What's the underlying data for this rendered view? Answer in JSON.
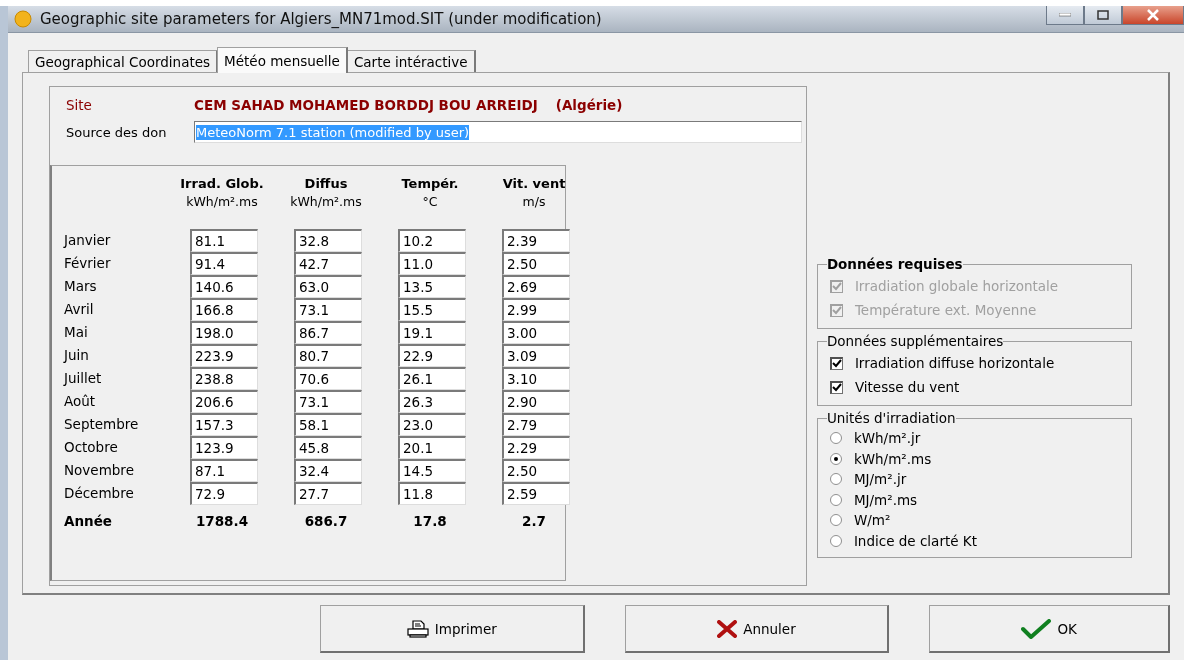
{
  "window": {
    "title": "Geographic site parameters for Algiers_MN71mod.SIT (under modification)"
  },
  "tabs": [
    {
      "label": "Geographical Coordinates",
      "selected": false
    },
    {
      "label": "Météo mensuelle",
      "selected": true
    },
    {
      "label": "Carte intéractive",
      "selected": false
    }
  ],
  "site": {
    "label": "Site",
    "name": "CEM SAHAD MOHAMED BORDDJ BOU ARREIDJ",
    "country": "(Algérie)"
  },
  "source": {
    "label": "Source des don",
    "value": "MeteoNorm 7.1 station (modified by user)",
    "text_selected": true
  },
  "table": {
    "columns": [
      {
        "title": "Irrad. Glob.",
        "unit": "kWh/m².ms"
      },
      {
        "title": "Diffus",
        "unit": "kWh/m².ms"
      },
      {
        "title": "Tempér.",
        "unit": "°C"
      },
      {
        "title": "Vit. vent",
        "unit": "m/s"
      }
    ],
    "rows": [
      {
        "month": "Janvier",
        "values": [
          "81.1",
          "32.8",
          "10.2",
          "2.39"
        ]
      },
      {
        "month": "Février",
        "values": [
          "91.4",
          "42.7",
          "11.0",
          "2.50"
        ]
      },
      {
        "month": "Mars",
        "values": [
          "140.6",
          "63.0",
          "13.5",
          "2.69"
        ]
      },
      {
        "month": "Avril",
        "values": [
          "166.8",
          "73.1",
          "15.5",
          "2.99"
        ]
      },
      {
        "month": "Mai",
        "values": [
          "198.0",
          "86.7",
          "19.1",
          "3.00"
        ]
      },
      {
        "month": "Juin",
        "values": [
          "223.9",
          "80.7",
          "22.9",
          "3.09"
        ]
      },
      {
        "month": "Juillet",
        "values": [
          "238.8",
          "70.6",
          "26.1",
          "3.10"
        ]
      },
      {
        "month": "Août",
        "values": [
          "206.6",
          "73.1",
          "26.3",
          "2.90"
        ]
      },
      {
        "month": "Septembre",
        "values": [
          "157.3",
          "58.1",
          "23.0",
          "2.79"
        ]
      },
      {
        "month": "Octobre",
        "values": [
          "123.9",
          "45.8",
          "20.1",
          "2.29"
        ]
      },
      {
        "month": "Novembre",
        "values": [
          "87.1",
          "32.4",
          "14.5",
          "2.50"
        ]
      },
      {
        "month": "Décembre",
        "values": [
          "72.9",
          "27.7",
          "11.8",
          "2.59"
        ]
      }
    ],
    "total": {
      "label": "Année",
      "values": [
        "1788.4",
        "686.7",
        "17.8",
        "2.7"
      ]
    }
  },
  "required": {
    "title": "Données requises",
    "items": [
      {
        "label": "Irradiation globale horizontale",
        "checked": true,
        "disabled": true
      },
      {
        "label": "Température ext. Moyenne",
        "checked": true,
        "disabled": true
      }
    ]
  },
  "extra": {
    "title": "Données supplémentaires",
    "items": [
      {
        "label": "Irradiation diffuse horizontale",
        "checked": true,
        "disabled": false
      },
      {
        "label": "Vitesse du vent",
        "checked": true,
        "disabled": false
      }
    ]
  },
  "units": {
    "title": "Unités d'irradiation",
    "options": [
      {
        "label": "kWh/m².jr",
        "selected": false
      },
      {
        "label": "kWh/m².ms",
        "selected": true
      },
      {
        "label": "MJ/m².jr",
        "selected": false
      },
      {
        "label": "MJ/m².ms",
        "selected": false
      },
      {
        "label": "W/m²",
        "selected": false
      },
      {
        "label": "Indice de clarté Kt",
        "selected": false
      }
    ]
  },
  "buttons": [
    {
      "kind": "print",
      "label": "Imprimer"
    },
    {
      "kind": "cancel",
      "label": "Annuler"
    },
    {
      "kind": "ok",
      "label": "OK"
    }
  ]
}
